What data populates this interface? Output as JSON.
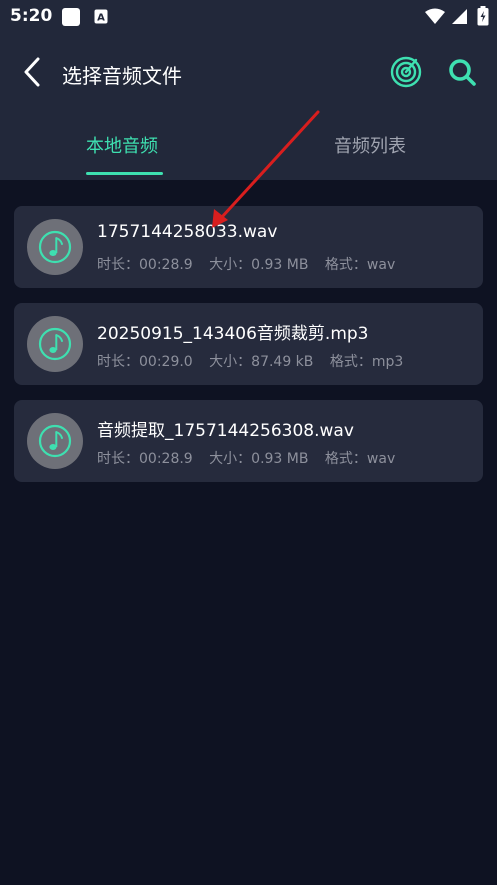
{
  "status_bar": {
    "time": "5:20"
  },
  "header": {
    "title": "选择音频文件",
    "icons": [
      "back-arrow-icon",
      "radar-scan-icon",
      "search-icon"
    ],
    "accent_color": "#3ee0b0"
  },
  "tabs": [
    {
      "label": "本地音频",
      "active": true
    },
    {
      "label": "音频列表",
      "active": false
    }
  ],
  "files": [
    {
      "name": "1757144258033.wav",
      "duration": "时长：00:28.9",
      "size": "大小：0.93 MB",
      "format": "格式：wav"
    },
    {
      "name": "20250915_143406音频裁剪.mp3",
      "duration": "时长：00:29.0",
      "size": "大小：87.49 kB",
      "format": "格式：mp3"
    },
    {
      "name": "音频提取_1757144256308.wav",
      "duration": "时长：00:28.9",
      "size": "大小：0.93 MB",
      "format": "格式：wav"
    }
  ],
  "colors": {
    "header_bg": "#22283a",
    "page_bg": "#0e1222",
    "card_bg": "#262b3d",
    "annotation_arrow": "#d81e1e"
  }
}
